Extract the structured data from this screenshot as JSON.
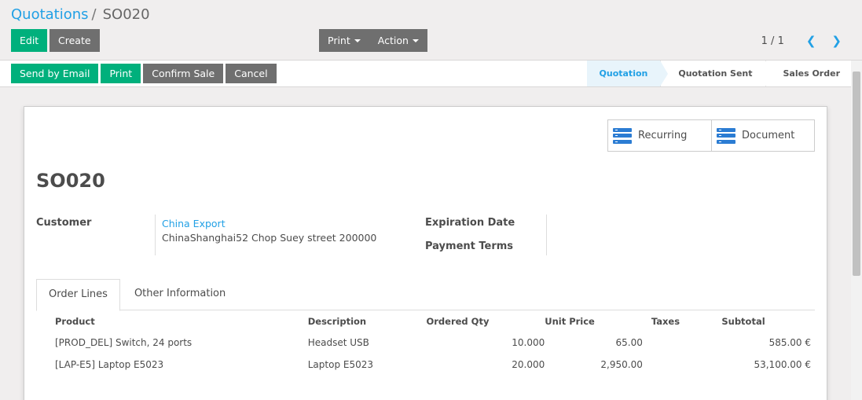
{
  "breadcrumb": {
    "parent": "Quotations",
    "separator": "/",
    "current": "SO020"
  },
  "control": {
    "edit_label": "Edit",
    "create_label": "Create",
    "print_label": "Print",
    "action_label": "Action"
  },
  "pager": {
    "value": "1 / 1",
    "prev_icon": "chevron-left-icon",
    "next_icon": "chevron-right-icon",
    "prev_glyph": "❮",
    "next_glyph": "❯"
  },
  "statusbar": {
    "send_email_label": "Send by Email",
    "print_label": "Print",
    "confirm_label": "Confirm Sale",
    "cancel_label": "Cancel",
    "stages": [
      "Quotation",
      "Quotation Sent",
      "Sales Order"
    ],
    "active_stage": "Quotation"
  },
  "smart_buttons": [
    {
      "label": "Recurring",
      "icon": "server-icon"
    },
    {
      "label": "Document",
      "icon": "server-icon"
    }
  ],
  "record": {
    "title": "SO020",
    "customer_label": "Customer",
    "customer_name": "China Export",
    "customer_address": "ChinaShanghai52 Chop Suey street 200000",
    "expiration_label": "Expiration Date",
    "payment_terms_label": "Payment Terms"
  },
  "tabs": [
    "Order Lines",
    "Other Information"
  ],
  "order_lines": {
    "headers": [
      "Product",
      "Description",
      "Ordered Qty",
      "Unit Price",
      "Taxes",
      "Subtotal"
    ],
    "rows": [
      {
        "product": "[PROD_DEL] Switch, 24 ports",
        "description": "Headset USB",
        "qty": "10.000",
        "price": "65.00",
        "taxes": "",
        "subtotal": "585.00 €"
      },
      {
        "product": "[LAP-E5] Laptop E5023",
        "description": "Laptop E5023",
        "qty": "20.000",
        "price": "2,950.00",
        "taxes": "",
        "subtotal": "53,100.00 €"
      }
    ]
  },
  "colors": {
    "accent": "#21a0e5",
    "primary": "#00b07c",
    "secondary": "#6f6f6f"
  }
}
